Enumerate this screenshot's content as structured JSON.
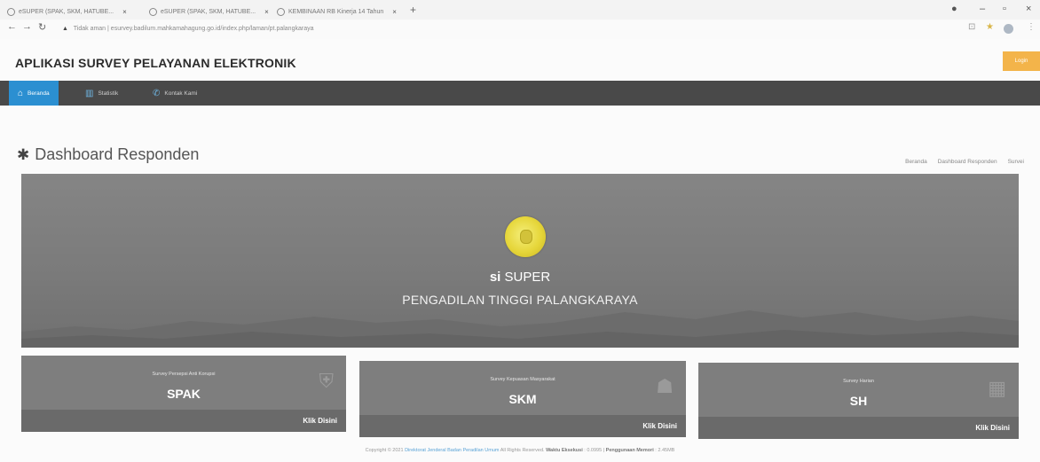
{
  "browser": {
    "tabs": [
      {
        "title": "eSUPER (SPAK, SKM, HATUBE..."
      },
      {
        "title": "eSUPER (SPAK, SKM, HATUBE..."
      },
      {
        "title": "KEMBINAAN RB Kinerja 14 Tahun"
      }
    ],
    "new_tab": "+",
    "url_warning": "Tidak aman",
    "url": "esurvey.badilum.mahkamahagung.go.id/index.php/laman/pt.palangkaraya"
  },
  "app": {
    "title": "APLIKASI SURVEY PELAYANAN ELEKTRONIK",
    "login_label": "Login"
  },
  "nav": {
    "items": [
      {
        "label": "Beranda",
        "icon": "home-icon",
        "active": true
      },
      {
        "label": "Statistik",
        "icon": "bar-chart-icon"
      },
      {
        "label": "Kontak Kami",
        "icon": "phone-icon"
      }
    ]
  },
  "page": {
    "heading": "Dashboard Responden",
    "breadcrumb": [
      "Beranda",
      "Dashboard Responden",
      "Survei"
    ]
  },
  "hero": {
    "app_prefix": "si",
    "app_name": "SUPER",
    "court": "PENGADILAN TINGGI PALANGKARAYA"
  },
  "cards": [
    {
      "subtitle": "Survey Persepsi Anti Korupsi",
      "abbr": "SPAK",
      "link": "Klik Disini",
      "icon": "shield-icon"
    },
    {
      "subtitle": "Survey Kepuasan Masyarakat",
      "abbr": "SKM",
      "link": "Klik Disini",
      "icon": "users-icon"
    },
    {
      "subtitle": "Survey Harian",
      "abbr": "SH",
      "link": "Klik Disini",
      "icon": "calendar-icon"
    }
  ],
  "footer": {
    "prefix": "Copyright © 2021",
    "org": "Direktorat Jenderal Badan Peradilan Umum",
    "rights": "All Rights Reserved.",
    "exec_label": "Waktu Eksekusi",
    "exec_value": "0.0995",
    "mem_label": "Penggunaan Memori",
    "mem_value": "2.45MB"
  },
  "colors": {
    "nav_bg": "#494949",
    "nav_active": "#2b8fd1",
    "login": "#f3b44a",
    "card_bg": "#7e7e7e",
    "hero_bg": "#7b7b7b",
    "emblem": "#e6d63a"
  }
}
